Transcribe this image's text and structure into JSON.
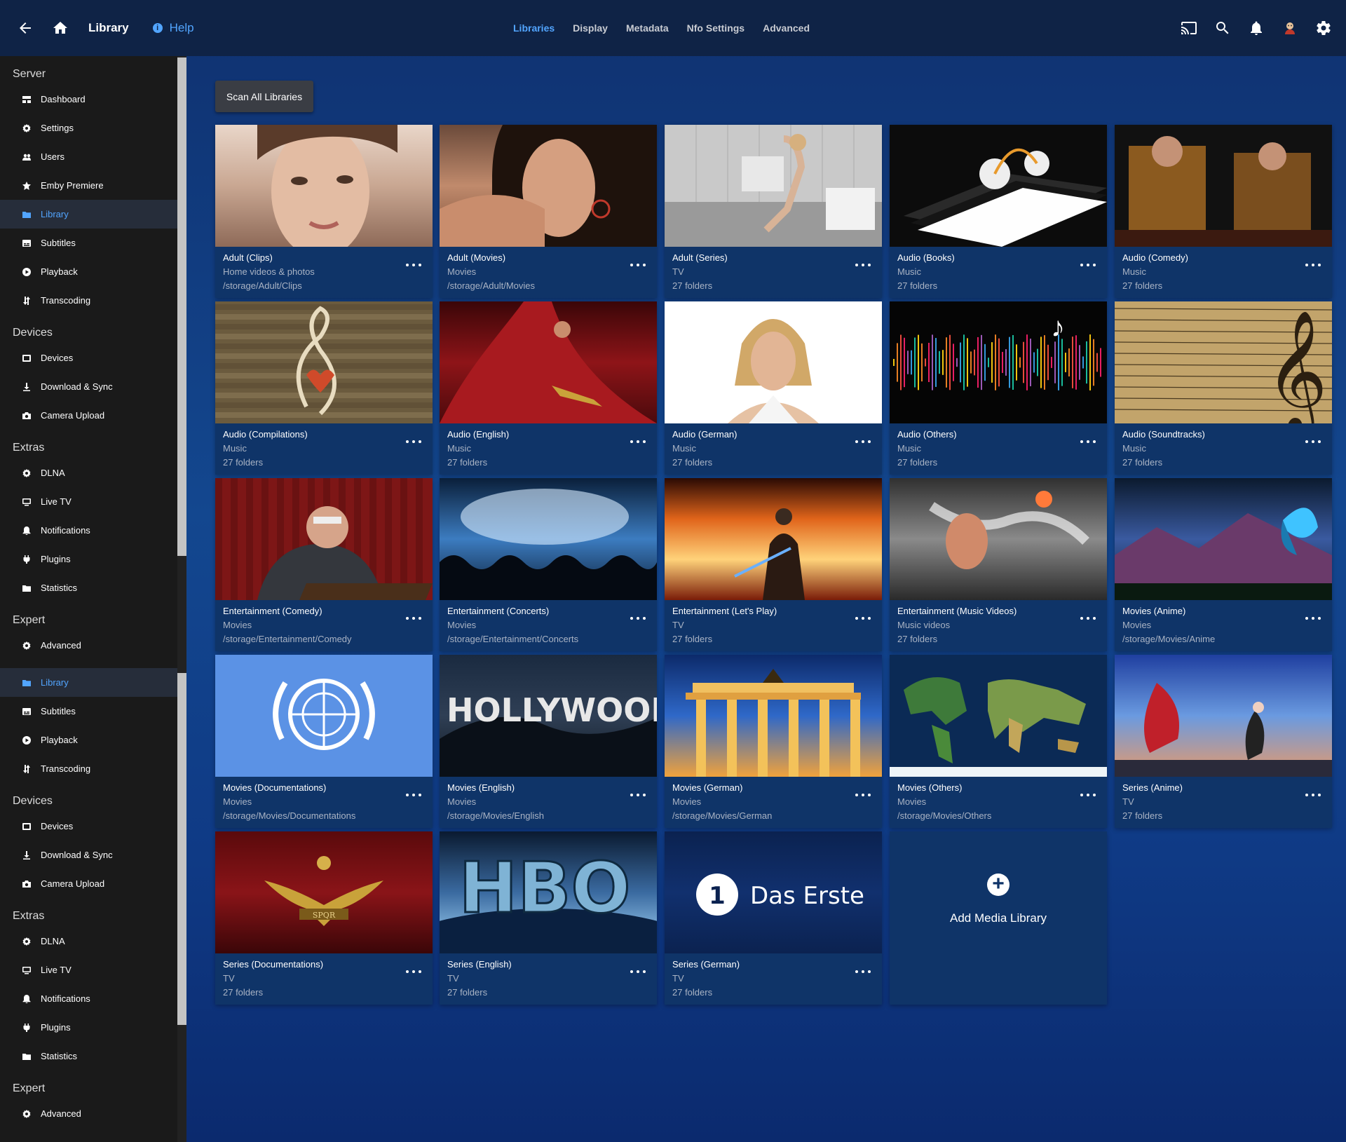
{
  "header": {
    "title": "Library",
    "help_label": "Help",
    "help_icon_glyph": "i",
    "tabs": [
      {
        "label": "Libraries",
        "active": true
      },
      {
        "label": "Display",
        "active": false
      },
      {
        "label": "Metadata",
        "active": false
      },
      {
        "label": "Nfo Settings",
        "active": false
      },
      {
        "label": "Advanced",
        "active": false
      }
    ],
    "icons": [
      "back-arrow-icon",
      "home-icon",
      "cast-icon",
      "search-icon",
      "notifications-bell-icon",
      "user-avatar-icon",
      "settings-gear-icon"
    ]
  },
  "sidebar": {
    "sections": [
      {
        "title": "Server",
        "items": [
          {
            "label": "Dashboard",
            "icon": "dashboard-icon"
          },
          {
            "label": "Settings",
            "icon": "gear-icon"
          },
          {
            "label": "Users",
            "icon": "users-icon"
          },
          {
            "label": "Emby Premiere",
            "icon": "star-icon"
          },
          {
            "label": "Library",
            "icon": "folder-icon",
            "active": true
          },
          {
            "label": "Subtitles",
            "icon": "subtitles-icon"
          },
          {
            "label": "Playback",
            "icon": "play-icon"
          },
          {
            "label": "Transcoding",
            "icon": "transcode-icon"
          }
        ]
      },
      {
        "title": "Devices",
        "items": [
          {
            "label": "Devices",
            "icon": "device-icon"
          },
          {
            "label": "Download & Sync",
            "icon": "download-icon"
          },
          {
            "label": "Camera Upload",
            "icon": "camera-icon"
          }
        ]
      },
      {
        "title": "Extras",
        "items": [
          {
            "label": "DLNA",
            "icon": "gear-icon"
          },
          {
            "label": "Live TV",
            "icon": "tv-icon"
          },
          {
            "label": "Notifications",
            "icon": "bell-icon"
          },
          {
            "label": "Plugins",
            "icon": "plugin-icon"
          },
          {
            "label": "Statistics",
            "icon": "folder-icon"
          }
        ]
      },
      {
        "title": "Expert",
        "items": [
          {
            "label": "Advanced",
            "icon": "gear-icon"
          }
        ]
      },
      {
        "title": "",
        "items": [
          {
            "label": "Library",
            "icon": "folder-icon",
            "active": true
          },
          {
            "label": "Subtitles",
            "icon": "subtitles-icon"
          },
          {
            "label": "Playback",
            "icon": "play-icon"
          },
          {
            "label": "Transcoding",
            "icon": "transcode-icon"
          }
        ]
      },
      {
        "title": "Devices",
        "items": [
          {
            "label": "Devices",
            "icon": "device-icon"
          },
          {
            "label": "Download & Sync",
            "icon": "download-icon"
          },
          {
            "label": "Camera Upload",
            "icon": "camera-icon"
          }
        ]
      },
      {
        "title": "Extras",
        "items": [
          {
            "label": "DLNA",
            "icon": "gear-icon"
          },
          {
            "label": "Live TV",
            "icon": "tv-icon"
          },
          {
            "label": "Notifications",
            "icon": "bell-icon"
          },
          {
            "label": "Plugins",
            "icon": "plugin-icon"
          },
          {
            "label": "Statistics",
            "icon": "folder-icon"
          }
        ]
      },
      {
        "title": "Expert",
        "items": [
          {
            "label": "Advanced",
            "icon": "gear-icon"
          }
        ]
      }
    ]
  },
  "main": {
    "scan_button_label": "Scan All Libraries",
    "add_library_label": "Add Media Library",
    "add_library_icon_glyph": "+",
    "libraries": [
      {
        "name": "Adult (Clips)",
        "type": "Home videos & photos",
        "detail": "/storage/Adult/Clips",
        "thumb": "portrait-woman"
      },
      {
        "name": "Adult (Movies)",
        "type": "Movies",
        "detail": "/storage/Adult/Movies",
        "thumb": "portrait-woman-dark"
      },
      {
        "name": "Adult (Series)",
        "type": "TV",
        "detail": "27 folders",
        "thumb": "bathroom"
      },
      {
        "name": "Audio (Books)",
        "type": "Music",
        "detail": "27 folders",
        "thumb": "books-headphones"
      },
      {
        "name": "Audio (Comedy)",
        "type": "Music",
        "detail": "27 folders",
        "thumb": "comedians"
      },
      {
        "name": "Audio (Compilations)",
        "type": "Music",
        "detail": "27 folders",
        "thumb": "word-cloud"
      },
      {
        "name": "Audio (English)",
        "type": "Music",
        "detail": "27 folders",
        "thumb": "red-dress"
      },
      {
        "name": "Audio (German)",
        "type": "Music",
        "detail": "27 folders",
        "thumb": "portrait-white"
      },
      {
        "name": "Audio (Others)",
        "type": "Music",
        "detail": "27 folders",
        "thumb": "sound-wave"
      },
      {
        "name": "Audio (Soundtracks)",
        "type": "Music",
        "detail": "27 folders",
        "thumb": "sheet-music"
      },
      {
        "name": "Entertainment (Comedy)",
        "type": "Movies",
        "detail": "/storage/Entertainment/Comedy",
        "thumb": "speaker-man"
      },
      {
        "name": "Entertainment (Concerts)",
        "type": "Movies",
        "detail": "/storage/Entertainment/Concerts",
        "thumb": "concert"
      },
      {
        "name": "Entertainment (Let's Play)",
        "type": "TV",
        "detail": "27 folders",
        "thumb": "fire-warrior"
      },
      {
        "name": "Entertainment (Music Videos)",
        "type": "Music videos",
        "detail": "27 folders",
        "thumb": "dancer"
      },
      {
        "name": "Movies (Anime)",
        "type": "Movies",
        "detail": "/storage/Movies/Anime",
        "thumb": "anime-butterfly"
      },
      {
        "name": "Movies (Documentations)",
        "type": "Movies",
        "detail": "/storage/Movies/Documentations",
        "thumb": "un-logo"
      },
      {
        "name": "Movies (English)",
        "type": "Movies",
        "detail": "/storage/Movies/English",
        "thumb": "hollywood"
      },
      {
        "name": "Movies (German)",
        "type": "Movies",
        "detail": "/storage/Movies/German",
        "thumb": "brandenburg-gate"
      },
      {
        "name": "Movies (Others)",
        "type": "Movies",
        "detail": "/storage/Movies/Others",
        "thumb": "world-map"
      },
      {
        "name": "Series (Anime)",
        "type": "TV",
        "detail": "27 folders",
        "thumb": "anime-sky"
      },
      {
        "name": "Series (Documentations)",
        "type": "TV",
        "detail": "27 folders",
        "thumb": "spqr-eagle"
      },
      {
        "name": "Series (English)",
        "type": "TV",
        "detail": "27 folders",
        "thumb": "hbo"
      },
      {
        "name": "Series (German)",
        "type": "TV",
        "detail": "27 folders",
        "thumb": "das-erste"
      }
    ],
    "thumb_text": {
      "hollywood": "HOLLYWOOD",
      "hbo": "HBO",
      "das-erste": "Das Erste",
      "das-erste-mark": "1",
      "spqr": "SPQR"
    }
  },
  "colors": {
    "accent": "#52a5ff",
    "header_bg": "#0f2346",
    "sidebar_bg": "#1a1a1a",
    "card_bg": "#0f3468"
  }
}
